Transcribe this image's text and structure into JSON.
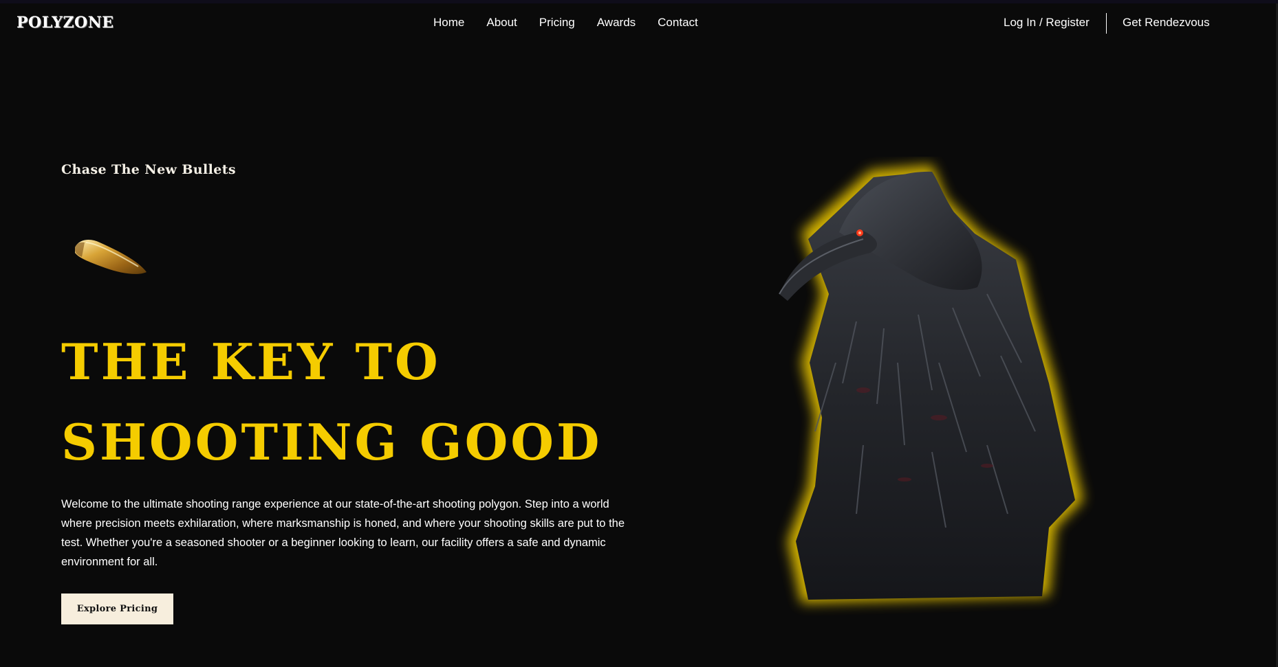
{
  "brand": {
    "name": "POLYZONE"
  },
  "nav": {
    "links": [
      "Home",
      "About",
      "Pricing",
      "Awards",
      "Contact"
    ],
    "login_label": "Log In / Register",
    "rendezvous_label": "Get Rendezvous"
  },
  "hero": {
    "tagline": "Chase The New Bullets",
    "headline_line1": "THE KEY TO",
    "headline_line2": "SHOOTING GOOD",
    "description": "Welcome to the ultimate shooting range experience at our state-of-the-art shooting polygon. Step into a world where precision meets exhilaration, where marksmanship is honed, and where your shooting skills are put to the test. Whether you're a seasoned shooter or a beginner looking to learn, our facility offers a safe and dynamic environment for all.",
    "cta_label": "Explore Pricing",
    "bullet_icon": "bullet-icon",
    "image_subject": "hooded-raven-warrior-illustration"
  },
  "colors": {
    "background": "#0a0a0a",
    "accent": "#f5cc00",
    "button_bg": "#f7eedd",
    "text": "#ffffff"
  }
}
